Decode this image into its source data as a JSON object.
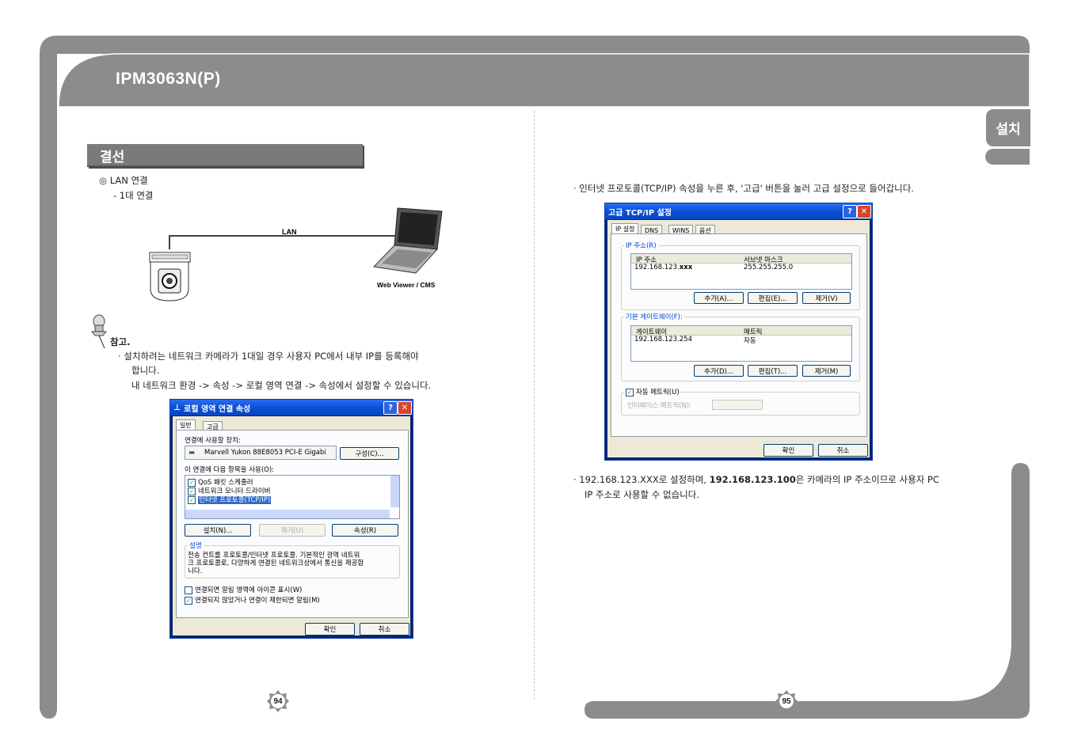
{
  "header": {
    "title": "IPM3063N(P)"
  },
  "side_tab": {
    "label": "설치"
  },
  "left_page": {
    "section_title": "결선",
    "lan_heading": "◎ LAN 연결",
    "lan_sub": "- 1대 연결",
    "diagram": {
      "lan_label": "LAN",
      "pc_label": "Web Viewer / CMS"
    },
    "note": {
      "title": "참고.",
      "line1": "· 설치하려는 네트워크 카메라가 1대일 경우 사용자 PC에서 내부 IP를 등록해야",
      "line2": "합니다.",
      "line3": "내 네트워크 환경 -> 속성 -> 로컬 영역 연결 -> 속성에서 설정할 수 있습니다."
    },
    "dialog": {
      "title": "로컬 영역 연결 속성",
      "tabs": [
        "일반",
        "고급"
      ],
      "connect_using_label": "연결에 사용할 장치:",
      "adapter": "Marvell Yukon 88E8053 PCI-E Gigabi",
      "configure_btn": "구성(C)...",
      "items_label": "이 연결에 다음 항목을 사용(O):",
      "items": [
        "QoS 패킷 스케줄러",
        "네트워크 모니터 드라이버",
        "인터넷 프로토콜(TCP/IP)"
      ],
      "install_btn": "설치(N)...",
      "uninstall_btn": "제거(U)",
      "properties_btn": "속성(R)",
      "desc_label": "설명",
      "desc_text1": "전송 컨트롤 프로토콜/인터넷 프로토콜. 기본적인 광역 네트워",
      "desc_text2": "크 프로토콜로, 다양하게 연결된 네트워크상에서 통신을 제공합",
      "desc_text3": "니다.",
      "check1": "연결되면 알림 영역에 아이콘 표시(W)",
      "check2": "연결되지 않았거나 연결이 제한되면 알림(M)",
      "ok_btn": "확인",
      "cancel_btn": "취소"
    },
    "page_number": "94"
  },
  "right_page": {
    "bullet1": "· 인터넷 프로토콜(TCP/IP) 속성을 누른 후, '고급' 버튼을 눌러 고급 설정으로 들어갑니다.",
    "dialog": {
      "title": "고급 TCP/IP 설정",
      "tabs": [
        "IP 설정",
        "DNS",
        "WINS",
        "옵션"
      ],
      "ip_group": "IP 주소(R)",
      "ip_col1": "IP 주소",
      "ip_col2": "서브넷 마스크",
      "ip_value_prefix": "192.168.123.",
      "ip_value_bold": "xxx",
      "mask_value": "255.255.255.0",
      "add_btn1": "추가(A)...",
      "edit_btn1": "편집(E)...",
      "remove_btn1": "제거(V)",
      "gw_group": "기본 게이트웨이(F):",
      "gw_col1": "게이트웨이",
      "gw_col2": "메트릭",
      "gw_value": "192.168.123.254",
      "gw_metric": "자동",
      "add_btn2": "추가(D)...",
      "edit_btn2": "편집(T)...",
      "remove_btn2": "제거(M)",
      "auto_metric": "자동 메트릭(U)",
      "iface_metric": "인터페이스 메트릭(N):",
      "ok_btn": "확인",
      "cancel_btn": "취소"
    },
    "bullet2_prefix": "· 192.168.123.XXX로 설정하며, ",
    "bullet2_bold": "192.168.123.100",
    "bullet2_suffix": "은 카메라의 IP 주소이므로 사용자 PC",
    "bullet2_line2": "IP 주소로 사용할 수 없습니다.",
    "page_number": "95"
  }
}
